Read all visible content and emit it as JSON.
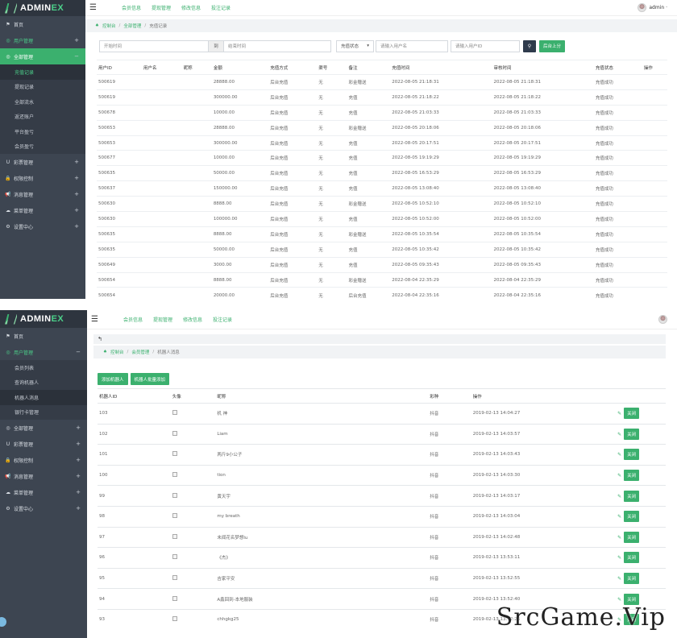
{
  "shot1": {
    "brand": {
      "main": "ADMIN",
      "accent": "EX"
    },
    "sidebar": [
      {
        "label": "首页",
        "icon": "flag-icon",
        "plus": ""
      },
      {
        "label": "用户管理",
        "icon": "circle-icon",
        "plus": "+",
        "green": true
      },
      {
        "label": "全部管理",
        "icon": "circle-icon",
        "plus": "−",
        "active": true,
        "children": [
          "充值记录",
          "提现记录",
          "全部流水",
          "返还账户",
          "平台盈亏",
          "会员盈亏"
        ],
        "current": 0
      },
      {
        "label": "彩票管理",
        "icon": "magnet-icon",
        "plus": "+"
      },
      {
        "label": "权限控制",
        "icon": "lock-icon",
        "plus": "+"
      },
      {
        "label": "消息管理",
        "icon": "bullhorn-icon",
        "plus": "+"
      },
      {
        "label": "菜单管理",
        "icon": "cloud-icon",
        "plus": "+"
      },
      {
        "label": "设置中心",
        "icon": "gear-icon",
        "plus": "+"
      }
    ],
    "topbar": {
      "links": [
        "会员信息",
        "提现管理",
        "修改信息",
        "投注记录"
      ],
      "user": "admin ·"
    },
    "breadcrumb": [
      "控制台",
      "全部管理",
      "充值记录"
    ],
    "filters": {
      "start_placeholder": "开始时间",
      "to": "到",
      "end_placeholder": "结束时间",
      "status": "充值状态",
      "user_placeholder": "请输入用户名",
      "uid_placeholder": "请输入用户ID",
      "search_icon": "search-icon",
      "manual_button": "后台上分"
    },
    "table": {
      "columns": [
        "用户ID",
        "用户名",
        "昵称",
        "金额",
        "充值方式",
        "渠号",
        "备注",
        "充值时间",
        "审核时间",
        "充值状态",
        "操作"
      ],
      "rows": [
        [
          "500619",
          "",
          "",
          "28888.00",
          "后台充值",
          "无",
          "彩金赠送",
          "2022-08-05 21:18:31",
          "2022-08-05 21:18:31",
          "充值成功",
          ""
        ],
        [
          "500619",
          "",
          "",
          "300000.00",
          "后台充值",
          "无",
          "充值",
          "2022-08-05 21:18:22",
          "2022-08-05 21:18:22",
          "充值成功",
          ""
        ],
        [
          "500678",
          "",
          "",
          "10000.00",
          "后台充值",
          "无",
          "充值",
          "2022-08-05 21:03:33",
          "2022-08-05 21:03:33",
          "充值成功",
          ""
        ],
        [
          "500653",
          "",
          "",
          "28888.00",
          "后台充值",
          "无",
          "彩金赠送",
          "2022-08-05 20:18:06",
          "2022-08-05 20:18:06",
          "充值成功",
          ""
        ],
        [
          "500653",
          "",
          "",
          "300000.00",
          "后台充值",
          "无",
          "充值",
          "2022-08-05 20:17:51",
          "2022-08-05 20:17:51",
          "充值成功",
          ""
        ],
        [
          "500677",
          "",
          "",
          "10000.00",
          "后台充值",
          "无",
          "充值",
          "2022-08-05 19:19:29",
          "2022-08-05 19:19:29",
          "充值成功",
          ""
        ],
        [
          "500635",
          "",
          "",
          "50000.00",
          "后台充值",
          "无",
          "充值",
          "2022-08-05 16:53:29",
          "2022-08-05 16:53:29",
          "充值成功",
          ""
        ],
        [
          "500637",
          "",
          "",
          "150000.00",
          "后台充值",
          "无",
          "充值",
          "2022-08-05 13:08:40",
          "2022-08-05 13:08:40",
          "充值成功",
          ""
        ],
        [
          "500630",
          "",
          "",
          "8888.00",
          "后台充值",
          "无",
          "彩金赠送",
          "2022-08-05 10:52:10",
          "2022-08-05 10:52:10",
          "充值成功",
          ""
        ],
        [
          "500630",
          "",
          "",
          "100000.00",
          "后台充值",
          "无",
          "充值",
          "2022-08-05 10:52:00",
          "2022-08-05 10:52:00",
          "充值成功",
          ""
        ],
        [
          "500635",
          "",
          "",
          "8888.00",
          "后台充值",
          "无",
          "彩金赠送",
          "2022-08-05 10:35:54",
          "2022-08-05 10:35:54",
          "充值成功",
          ""
        ],
        [
          "500635",
          "",
          "",
          "50000.00",
          "后台充值",
          "无",
          "充值",
          "2022-08-05 10:35:42",
          "2022-08-05 10:35:42",
          "充值成功",
          ""
        ],
        [
          "500649",
          "",
          "",
          "3000.00",
          "后台充值",
          "无",
          "充值",
          "2022-08-05 09:35:43",
          "2022-08-05 09:35:43",
          "充值成功",
          ""
        ],
        [
          "500654",
          "",
          "",
          "8888.00",
          "后台充值",
          "无",
          "彩金赠送",
          "2022-08-04 22:35:29",
          "2022-08-04 22:35:29",
          "充值成功",
          ""
        ],
        [
          "500654",
          "",
          "",
          "20000.00",
          "后台充值",
          "无",
          "后台充值",
          "2022-08-04 22:35:16",
          "2022-08-04 22:35:16",
          "充值成功",
          ""
        ]
      ]
    }
  },
  "shot2": {
    "brand": {
      "main": "ADMIN",
      "accent": "EX"
    },
    "sidebar": [
      {
        "label": "首页",
        "icon": "flag-icon",
        "plus": ""
      },
      {
        "label": "用户管理",
        "icon": "circle-icon",
        "plus": "−",
        "green": true,
        "children": [
          "会员列表",
          "查询机器人",
          "机器人消息",
          "银行卡管理"
        ],
        "current": 2
      },
      {
        "label": "全部管理",
        "icon": "circle-icon",
        "plus": "+"
      },
      {
        "label": "彩票管理",
        "icon": "magnet-icon",
        "plus": "+"
      },
      {
        "label": "权限控制",
        "icon": "lock-icon",
        "plus": "+"
      },
      {
        "label": "消息管理",
        "icon": "bullhorn-icon",
        "plus": "+"
      },
      {
        "label": "菜单管理",
        "icon": "cloud-icon",
        "plus": "+"
      },
      {
        "label": "设置中心",
        "icon": "gear-icon",
        "plus": "+"
      }
    ],
    "topbar": {
      "links": [
        "会员信息",
        "提现管理",
        "修改信息",
        "投注记录"
      ]
    },
    "back": "↰",
    "breadcrumb": [
      "控制台",
      "会员管理",
      "机器人消息"
    ],
    "actions": [
      "添加机器人",
      "机器人批量添加"
    ],
    "table": {
      "columns": [
        "机器人ID",
        "头像",
        "昵称",
        "彩种",
        "操作"
      ],
      "rows": [
        [
          "103",
          "机 神",
          "抖音",
          "2019-02-13 14:04:27"
        ],
        [
          "102",
          "Liam",
          "抖音",
          "2019-02-13 14:03:57"
        ],
        [
          "101",
          "两斤9小公子",
          "抖音",
          "2019-02-13 14:03:43"
        ],
        [
          "100",
          "tion",
          "抖音",
          "2019-02-13 14:03:30"
        ],
        [
          "99",
          "黄天宇",
          "抖音",
          "2019-02-13 14:03:17"
        ],
        [
          "98",
          "my breath",
          "抖音",
          "2019-02-13 14:03:04"
        ],
        [
          "97",
          "未闻花名梦想lu",
          "抖音",
          "2019-02-13 14:02:48"
        ],
        [
          "96",
          "《杰》",
          "抖音",
          "2019-02-13 13:53:11"
        ],
        [
          "95",
          "吉家平安",
          "抖音",
          "2019-02-13 13:52:55"
        ],
        [
          "94",
          "A鑫回到-本地服装",
          "抖音",
          "2019-02-13 13:52:40"
        ],
        [
          "93",
          "chhgkg25",
          "抖音",
          "2019-02-13 13:52:26"
        ]
      ],
      "close_label": "关闭"
    },
    "watermark": "SrcGame.Vip"
  }
}
